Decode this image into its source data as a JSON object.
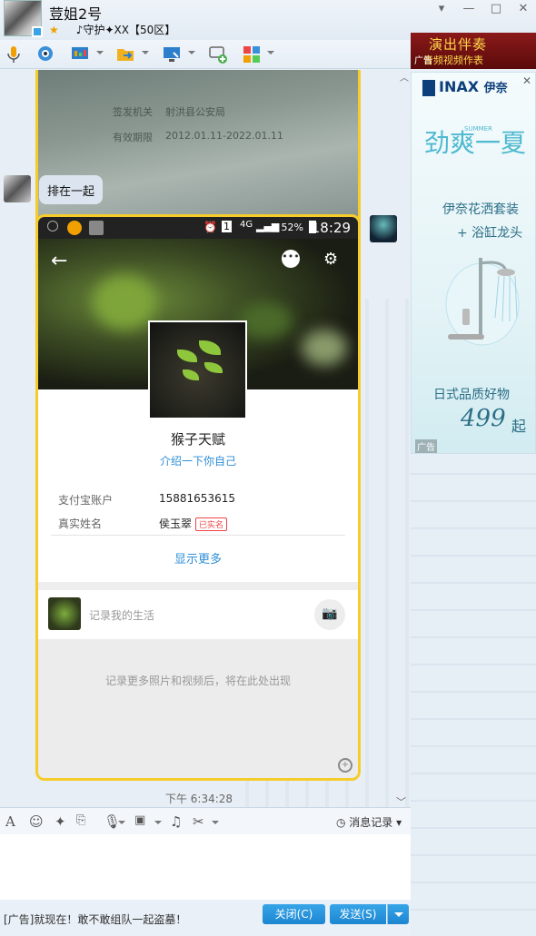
{
  "window": {
    "contact_name": "荳姐2号",
    "contact_status": "ﾠ♪守护✦XX【50区】",
    "controls": [
      "▾",
      "—",
      "□",
      "✕"
    ]
  },
  "toolbar": {
    "icons": [
      "microphone-icon",
      "video-icon",
      "screen-share-icon",
      "send-file-icon",
      "remote-desktop-icon",
      "new-group-icon",
      "apps-icon"
    ]
  },
  "chat": {
    "id_card": {
      "line1_label": "签发机关",
      "line1_value": "射洪县公安局",
      "line2_label": "有效期限",
      "line2_value": "2012.01.11-2022.01.11"
    },
    "text_message": "排在一起",
    "timestamp": "下午 6:34:28",
    "phone": {
      "time": "18:29",
      "battery": "52%",
      "network": "4G",
      "sim": "1",
      "profile_name": "猴子天赋",
      "profile_intro": "介绍一下你自己",
      "alipay_label": "支付宝账户",
      "alipay_value": "15881653615",
      "realname_label": "真实姓名",
      "realname_value": "侯玉翠",
      "verified_badge": "已实名",
      "show_more": "显示更多",
      "life_label": "记录我的生活",
      "empty_hint": "记录更多照片和视频后，将在此处出现"
    }
  },
  "ads": {
    "top_ad": {
      "line1": "演出伴奏",
      "line2": "音频视频作表",
      "tag": "广告"
    },
    "side_ad": {
      "brand": "INAX",
      "brand_cn": "伊奈",
      "slogan": "劲爽一夏",
      "summer_word": "SUMMER",
      "line1": "伊奈花洒套装",
      "line2": "+ 浴缸龙头",
      "line3": "日式品质好物",
      "price": "499",
      "price_unit": "起",
      "tag": "广告"
    }
  },
  "input": {
    "history_label": "消息记录",
    "bottom_ad": "[广告]就现在！敢不敢组队一起盗墓！",
    "close_button": "关闭(C)",
    "send_button": "发送(S)"
  }
}
